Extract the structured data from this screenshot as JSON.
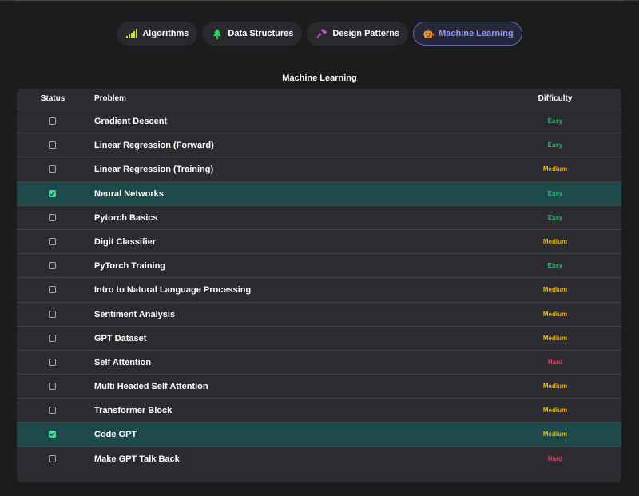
{
  "tabs": [
    {
      "label": "Algorithms",
      "icon": "signal-bars-icon",
      "active": false
    },
    {
      "label": "Data Structures",
      "icon": "tree-icon",
      "active": false
    },
    {
      "label": "Design Patterns",
      "icon": "hammer-icon",
      "active": false
    },
    {
      "label": "Machine Learning",
      "icon": "robot-icon",
      "active": true
    }
  ],
  "section_title": "Machine Learning",
  "table": {
    "headers": {
      "status": "Status",
      "problem": "Problem",
      "difficulty": "Difficulty"
    },
    "rows": [
      {
        "name": "Gradient Descent",
        "difficulty": "Easy",
        "done": false
      },
      {
        "name": "Linear Regression (Forward)",
        "difficulty": "Easy",
        "done": false
      },
      {
        "name": "Linear Regression (Training)",
        "difficulty": "Medium",
        "done": false
      },
      {
        "name": "Neural Networks",
        "difficulty": "Easy",
        "done": true
      },
      {
        "name": "Pytorch Basics",
        "difficulty": "Easy",
        "done": false
      },
      {
        "name": "Digit Classifier",
        "difficulty": "Medium",
        "done": false
      },
      {
        "name": "PyTorch Training",
        "difficulty": "Easy",
        "done": false
      },
      {
        "name": "Intro to Natural Language Processing",
        "difficulty": "Medium",
        "done": false
      },
      {
        "name": "Sentiment Analysis",
        "difficulty": "Medium",
        "done": false
      },
      {
        "name": "GPT Dataset",
        "difficulty": "Medium",
        "done": false
      },
      {
        "name": "Self Attention",
        "difficulty": "Hard",
        "done": false
      },
      {
        "name": "Multi Headed Self Attention",
        "difficulty": "Medium",
        "done": false
      },
      {
        "name": "Transformer Block",
        "difficulty": "Medium",
        "done": false
      },
      {
        "name": "Code GPT",
        "difficulty": "Medium",
        "done": true
      },
      {
        "name": "Make GPT Talk Back",
        "difficulty": "Hard",
        "done": false
      }
    ]
  },
  "colors": {
    "easy": "#2bb673",
    "medium": "#f5b400",
    "hard": "#e5405e",
    "completed_row": "#1e4a4c",
    "active_tab_text": "#8f9bf0"
  }
}
